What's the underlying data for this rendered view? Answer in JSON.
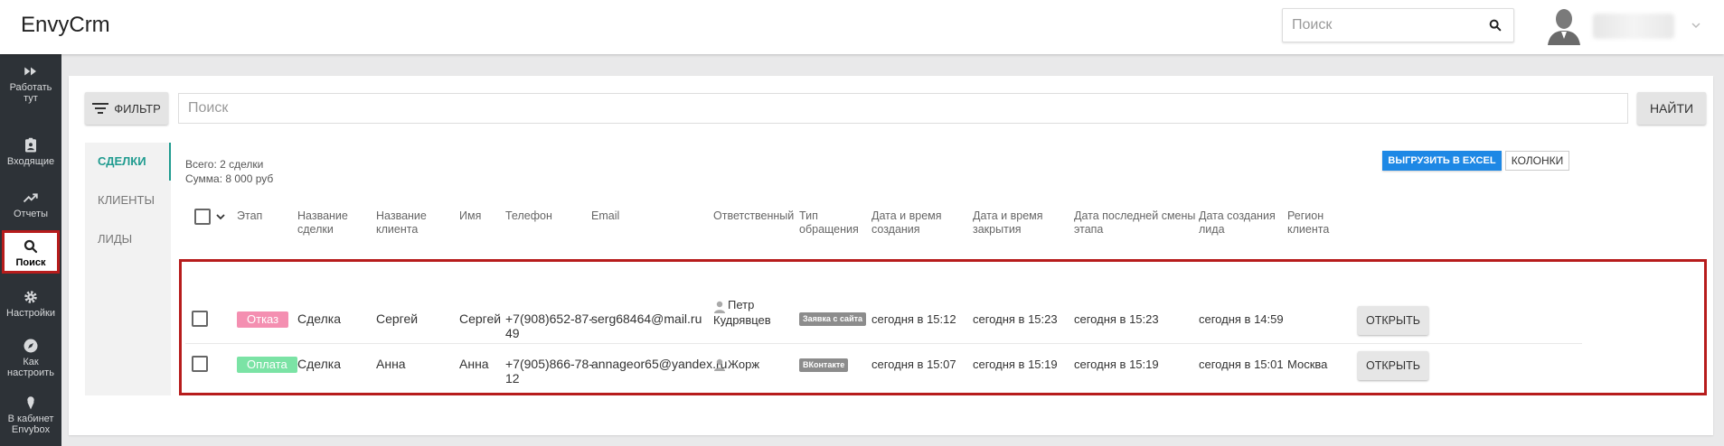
{
  "app": {
    "title": "EnvyCrm"
  },
  "topbar": {
    "search_placeholder": "Поиск"
  },
  "sidebar": {
    "items": [
      {
        "label": "Работать тут",
        "icon": "fast-forward-icon"
      },
      {
        "label": "Входящие",
        "icon": "inbox-badge-icon"
      },
      {
        "label": "Отчеты",
        "icon": "trending-up-icon"
      },
      {
        "label": "Поиск",
        "icon": "search-icon",
        "active": true
      },
      {
        "label": "Настройки",
        "icon": "gear-icon"
      },
      {
        "label": "Как настроить",
        "icon": "compass-icon"
      },
      {
        "label": "В кабинет Envybox",
        "icon": "ice-cream-icon"
      }
    ]
  },
  "toolbar": {
    "filter_label": "ФИЛЬТР",
    "search_placeholder": "Поиск",
    "find_label": "НАЙТИ"
  },
  "tabs": [
    "СДЕЛКИ",
    "КЛИЕНТЫ",
    "ЛИДЫ"
  ],
  "summary": {
    "total": "Всего: 2 сделки",
    "sum": "Сумма: 8 000 руб"
  },
  "actions": {
    "export_label": "ВЫГРУЗИТЬ В EXCEL",
    "columns_label": "КОЛОНКИ"
  },
  "table": {
    "headers": {
      "stage": "Этап",
      "deal_name_1": "Название",
      "deal_name_2": "сделки",
      "client_name_1": "Название",
      "client_name_2": "клиента",
      "name": "Имя",
      "phone": "Телефон",
      "email": "Email",
      "responsible": "Ответственный",
      "type_1": "Тип",
      "type_2": "обращения",
      "created_1": "Дата и время",
      "created_2": "создания",
      "closed_1": "Дата и время",
      "closed_2": "закрытия",
      "stage_change_1": "Дата последней смены",
      "stage_change_2": "этапа",
      "lead_created_1": "Дата создания",
      "lead_created_2": "лида",
      "region_1": "Регион",
      "region_2": "клиента"
    },
    "rows": [
      {
        "stage": "Отказ",
        "stage_color": "#f48fb1",
        "deal_name": "Сделка",
        "client_name": "Сергей",
        "name": "Сергей",
        "phone_1": "+7(908)652-87-",
        "phone_2": "49",
        "email": "serg68464@mail.ru",
        "responsible_1": "Петр",
        "responsible_2": "Кудрявцев",
        "type": "Заявка с сайта",
        "created": "сегодня в 15:12",
        "closed": "сегодня в 15:23",
        "stage_changed": "сегодня в 15:23",
        "lead_created": "сегодня в 14:59",
        "region": "",
        "open_label": "ОТКРЫТЬ"
      },
      {
        "stage": "Оплата",
        "stage_color": "#7be3a5",
        "deal_name": "Сделка",
        "client_name": "Анна",
        "name": "Анна",
        "phone_1": "+7(905)866-78-",
        "phone_2": "12",
        "email": "annageor65@yandex.ru",
        "responsible_1": "Жорж",
        "responsible_2": "",
        "type": "ВКонтакте",
        "created": "сегодня в 15:07",
        "closed": "сегодня в 15:19",
        "stage_changed": "сегодня в 15:19",
        "lead_created": "сегодня в 15:01",
        "region": "Москва",
        "open_label": "ОТКРЫТЬ"
      }
    ]
  },
  "colors": {
    "accent": "#1f9b8f",
    "excel_button": "#1e88e5",
    "highlight": "#b71c1c",
    "sidebar": "#2d3237"
  }
}
